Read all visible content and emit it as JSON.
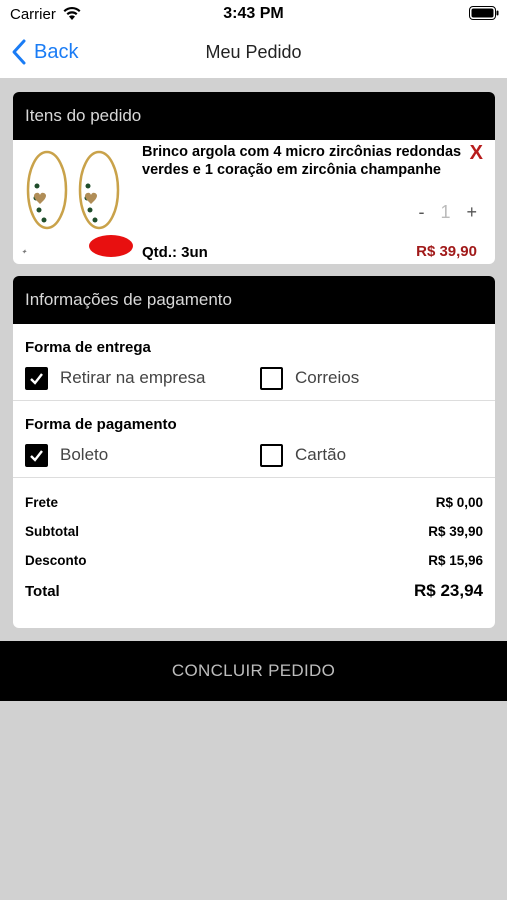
{
  "status_bar": {
    "carrier": "Carrier",
    "time": "3:43 PM"
  },
  "nav": {
    "back_label": "Back",
    "title": "Meu Pedido"
  },
  "items_section": {
    "title": "Itens do pedido",
    "items": [
      {
        "name": "Brinco argola com 4 micro zircônias redondas verdes e 1 coração em zircônia champanhe",
        "remove_label": "X",
        "minus_label": "-",
        "quantity": "1",
        "plus_label": "+",
        "qty_label": "Qtd.: 3un",
        "price": "R$ 39,90"
      }
    ]
  },
  "payment_section": {
    "title": "Informações de pagamento",
    "delivery": {
      "label": "Forma de entrega",
      "options": [
        {
          "label": "Retirar na empresa",
          "checked": true
        },
        {
          "label": "Correios",
          "checked": false
        }
      ]
    },
    "payment": {
      "label": "Forma de pagamento",
      "options": [
        {
          "label": "Boleto",
          "checked": true
        },
        {
          "label": "Cartão",
          "checked": false
        }
      ]
    },
    "totals": {
      "frete_label": "Frete",
      "frete_value": "R$ 0,00",
      "subtotal_label": "Subtotal",
      "subtotal_value": "R$ 39,90",
      "desconto_label": "Desconto",
      "desconto_value": "R$ 15,96",
      "total_label": "Total",
      "total_value": "R$ 23,94"
    }
  },
  "conclude_button": {
    "label": "CONCLUIR PEDIDO"
  },
  "colors": {
    "accent": "#1a7cf5",
    "price": "#a11a1a",
    "header": "#000000",
    "background": "#d1d1d1"
  }
}
